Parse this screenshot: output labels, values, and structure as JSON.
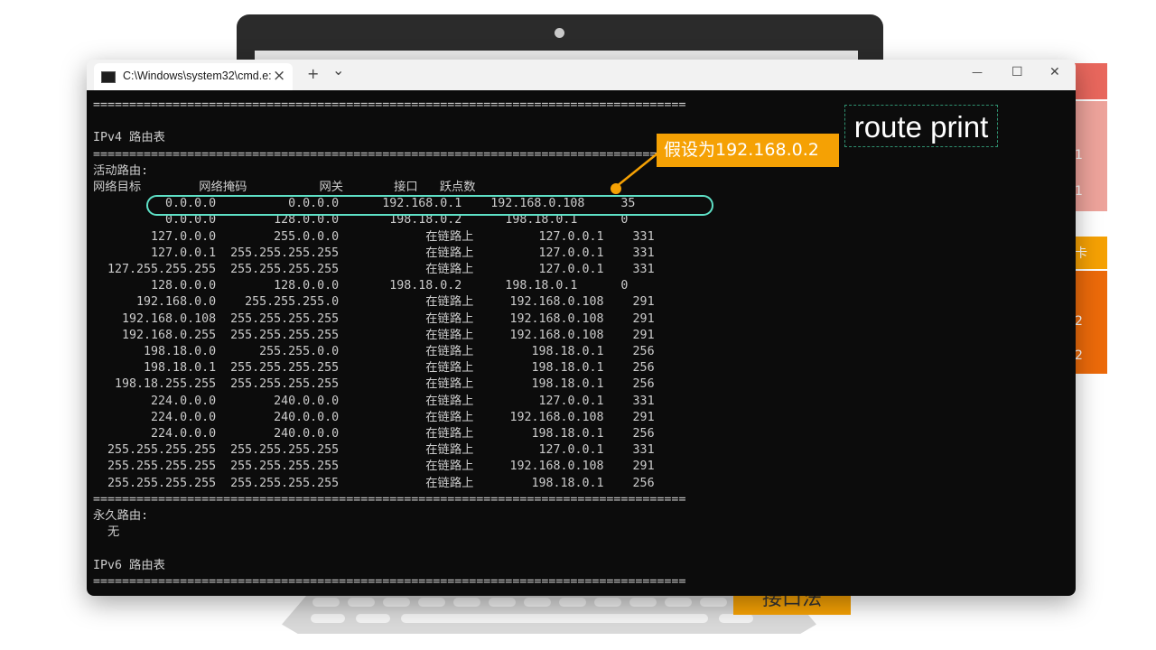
{
  "window": {
    "tab_title": "C:\\Windows\\system32\\cmd.e:",
    "tab_close_icon": "×",
    "new_tab_icon": "+",
    "dropdown_icon": "⌄",
    "minimize_icon": "—",
    "maximize_icon": "☐",
    "close_icon": "✕"
  },
  "terminal": {
    "text": "==================================================================================\n\nIPv4 路由表\n==================================================================================\n活动路由:\n网络目标        网络掩码          网关       接口   跃点数\n          0.0.0.0          0.0.0.0      192.168.0.1    192.168.0.108     35\n          0.0.0.0        128.0.0.0       198.18.0.2      198.18.0.1      0\n        127.0.0.0        255.0.0.0            在链路上         127.0.0.1    331\n        127.0.0.1  255.255.255.255            在链路上         127.0.0.1    331\n  127.255.255.255  255.255.255.255            在链路上         127.0.0.1    331\n        128.0.0.0        128.0.0.0       198.18.0.2      198.18.0.1      0\n      192.168.0.0    255.255.255.0            在链路上     192.168.0.108    291\n    192.168.0.108  255.255.255.255            在链路上     192.168.0.108    291\n    192.168.0.255  255.255.255.255            在链路上     192.168.0.108    291\n       198.18.0.0      255.255.0.0            在链路上        198.18.0.1    256\n       198.18.0.1  255.255.255.255            在链路上        198.18.0.1    256\n   198.18.255.255  255.255.255.255            在链路上        198.18.0.1    256\n        224.0.0.0        240.0.0.0            在链路上         127.0.0.1    331\n        224.0.0.0        240.0.0.0            在链路上     192.168.0.108    291\n        224.0.0.0        240.0.0.0            在链路上        198.18.0.1    256\n  255.255.255.255  255.255.255.255            在链路上         127.0.0.1    331\n  255.255.255.255  255.255.255.255            在链路上     192.168.0.108    291\n  255.255.255.255  255.255.255.255            在链路上        198.18.0.1    256\n==================================================================================\n永久路由:\n  无\n\nIPv6 路由表\n=================================================================================="
  },
  "annotations": {
    "callout_text": "假设为192.168.0.2",
    "caption_text": "route print",
    "highlight_color": "#5ee0c6",
    "callout_color": "#f5a104"
  },
  "background": {
    "bottom_label": "接口法",
    "side_fragments": [
      "1",
      "1",
      "卡",
      "2",
      "2"
    ],
    "side_colors": [
      "#e8675d",
      "#eda39b",
      "#f5a104",
      "#ec6a0a"
    ]
  }
}
